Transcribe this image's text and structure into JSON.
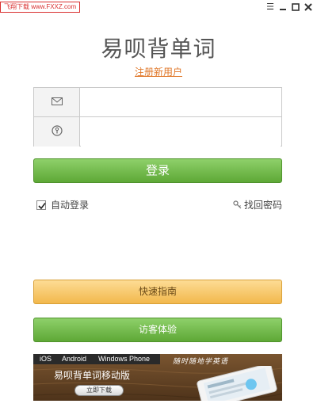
{
  "titlebar": {
    "watermark": "飞翔下载 www.FXXZ.com",
    "menu_icon": "menu-icon",
    "minimize_icon": "minimize-icon",
    "maximize_icon": "maximize-icon",
    "close_icon": "close-icon"
  },
  "header": {
    "app_title": "易呗背单词",
    "register_link": "注册新用户"
  },
  "login_form": {
    "email_icon": "envelope-icon",
    "email_value": "",
    "password_icon": "key-icon",
    "password_value": ""
  },
  "buttons": {
    "login": "登录",
    "guide": "快速指南",
    "guest": "访客体验"
  },
  "options": {
    "auto_login_label": "自动登录",
    "auto_login_checked": true,
    "forgot_password_label": "找回密码"
  },
  "banner": {
    "platforms": [
      "iOS",
      "Android",
      "Windows Phone"
    ],
    "title": "易呗背单词移动版",
    "download_button": "立即下载",
    "slogan": "随时随地学英语"
  },
  "colors": {
    "accent_green": "#5ea836",
    "accent_orange": "#f2b84c",
    "link_orange": "#e0782a"
  }
}
